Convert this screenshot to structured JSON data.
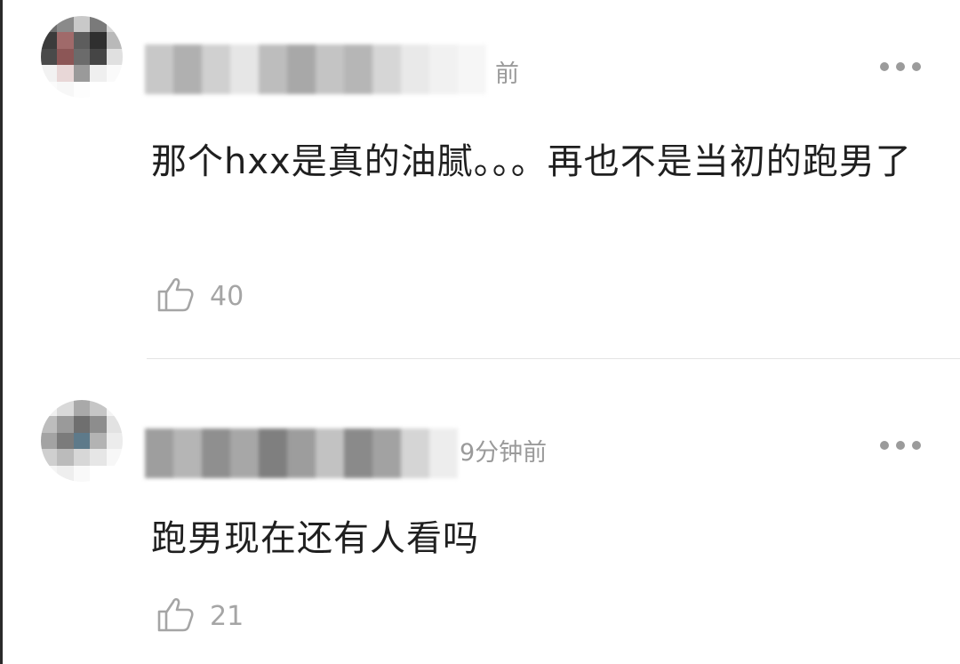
{
  "comments": [
    {
      "username": "",
      "time": "前",
      "text": "那个hxx是真的油腻。。。再也不是当初的跑男了",
      "likes": "40"
    },
    {
      "username": "",
      "time": "9分钟前",
      "text": "跑男现在还有人看吗",
      "likes": "21"
    }
  ],
  "icons": {
    "more": "more-horizontal-icon",
    "like": "thumbs-up-icon"
  },
  "colors": {
    "background": "#ffffff",
    "text": "#1f1f1f",
    "meta": "#9a9a9a",
    "divider": "#e3e3e3"
  }
}
